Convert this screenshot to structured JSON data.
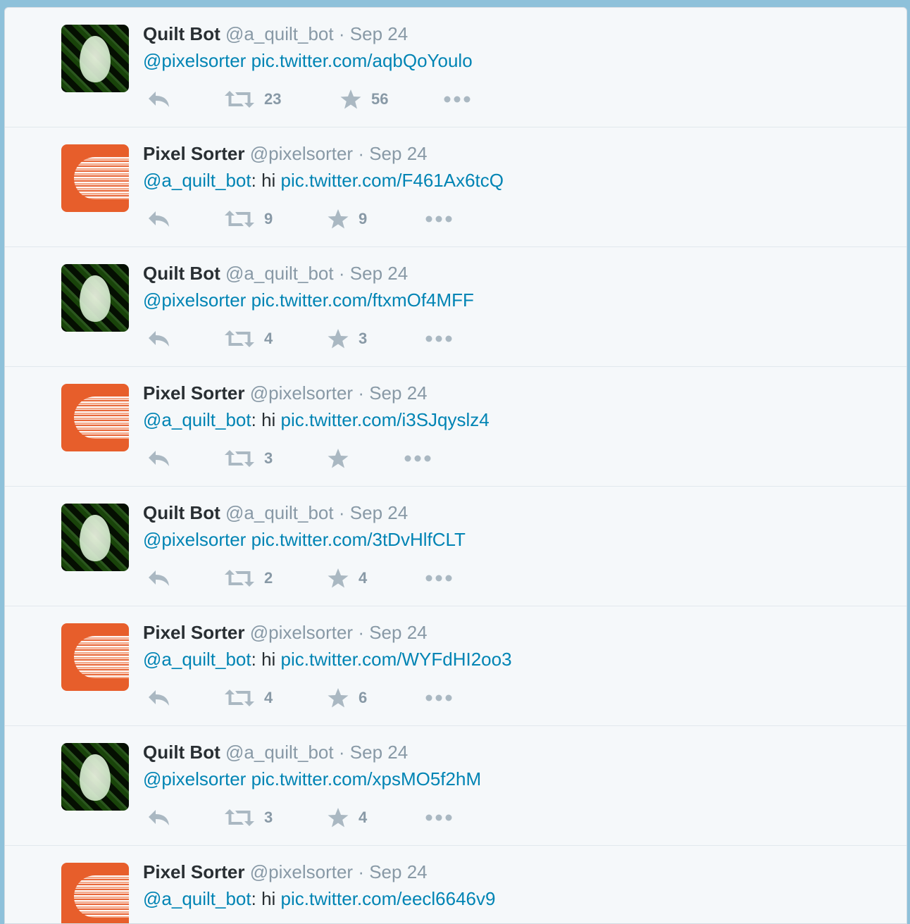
{
  "tweets": [
    {
      "avatar": "quilt",
      "name": "Quilt Bot",
      "handle": "@a_quilt_bot",
      "separator": "·",
      "date": "Sep 24",
      "mention": "@pixelsorter",
      "colon": "",
      "body": " ",
      "link": "pic.twitter.com/aqbQoYoulo",
      "retweets": "23",
      "favorites": "56"
    },
    {
      "avatar": "pixel",
      "name": "Pixel Sorter",
      "handle": "@pixelsorter",
      "separator": "·",
      "date": "Sep 24",
      "mention": "@a_quilt_bot",
      "colon": ":",
      "body": " hi ",
      "link": "pic.twitter.com/F461Ax6tcQ",
      "retweets": "9",
      "favorites": "9"
    },
    {
      "avatar": "quilt",
      "name": "Quilt Bot",
      "handle": "@a_quilt_bot",
      "separator": "·",
      "date": "Sep 24",
      "mention": "@pixelsorter",
      "colon": "",
      "body": " ",
      "link": "pic.twitter.com/ftxmOf4MFF",
      "retweets": "4",
      "favorites": "3"
    },
    {
      "avatar": "pixel",
      "name": "Pixel Sorter",
      "handle": "@pixelsorter",
      "separator": "·",
      "date": "Sep 24",
      "mention": "@a_quilt_bot",
      "colon": ":",
      "body": " hi ",
      "link": "pic.twitter.com/i3SJqyslz4",
      "retweets": "3",
      "favorites": ""
    },
    {
      "avatar": "quilt",
      "name": "Quilt Bot",
      "handle": "@a_quilt_bot",
      "separator": "·",
      "date": "Sep 24",
      "mention": "@pixelsorter",
      "colon": "",
      "body": " ",
      "link": "pic.twitter.com/3tDvHlfCLT",
      "retweets": "2",
      "favorites": "4"
    },
    {
      "avatar": "pixel",
      "name": "Pixel Sorter",
      "handle": "@pixelsorter",
      "separator": "·",
      "date": "Sep 24",
      "mention": "@a_quilt_bot",
      "colon": ":",
      "body": " hi ",
      "link": "pic.twitter.com/WYFdHI2oo3",
      "retweets": "4",
      "favorites": "6"
    },
    {
      "avatar": "quilt",
      "name": "Quilt Bot",
      "handle": "@a_quilt_bot",
      "separator": "·",
      "date": "Sep 24",
      "mention": "@pixelsorter",
      "colon": "",
      "body": " ",
      "link": "pic.twitter.com/xpsMO5f2hM",
      "retweets": "3",
      "favorites": "4"
    },
    {
      "avatar": "pixel",
      "name": "Pixel Sorter",
      "handle": "@pixelsorter",
      "separator": "·",
      "date": "Sep 24",
      "mention": "@a_quilt_bot",
      "colon": ":",
      "body": " hi ",
      "link": "pic.twitter.com/eecl6646v9",
      "retweets": "",
      "favorites": ""
    }
  ],
  "icons": {
    "reply": "reply-icon",
    "retweet": "retweet-icon",
    "favorite": "star-icon",
    "more": "more-icon"
  },
  "colors": {
    "link": "#0084b4",
    "name": "#292f33",
    "meta": "#8899a6",
    "icon": "#aab8c2",
    "background": "#f5f8fa"
  }
}
